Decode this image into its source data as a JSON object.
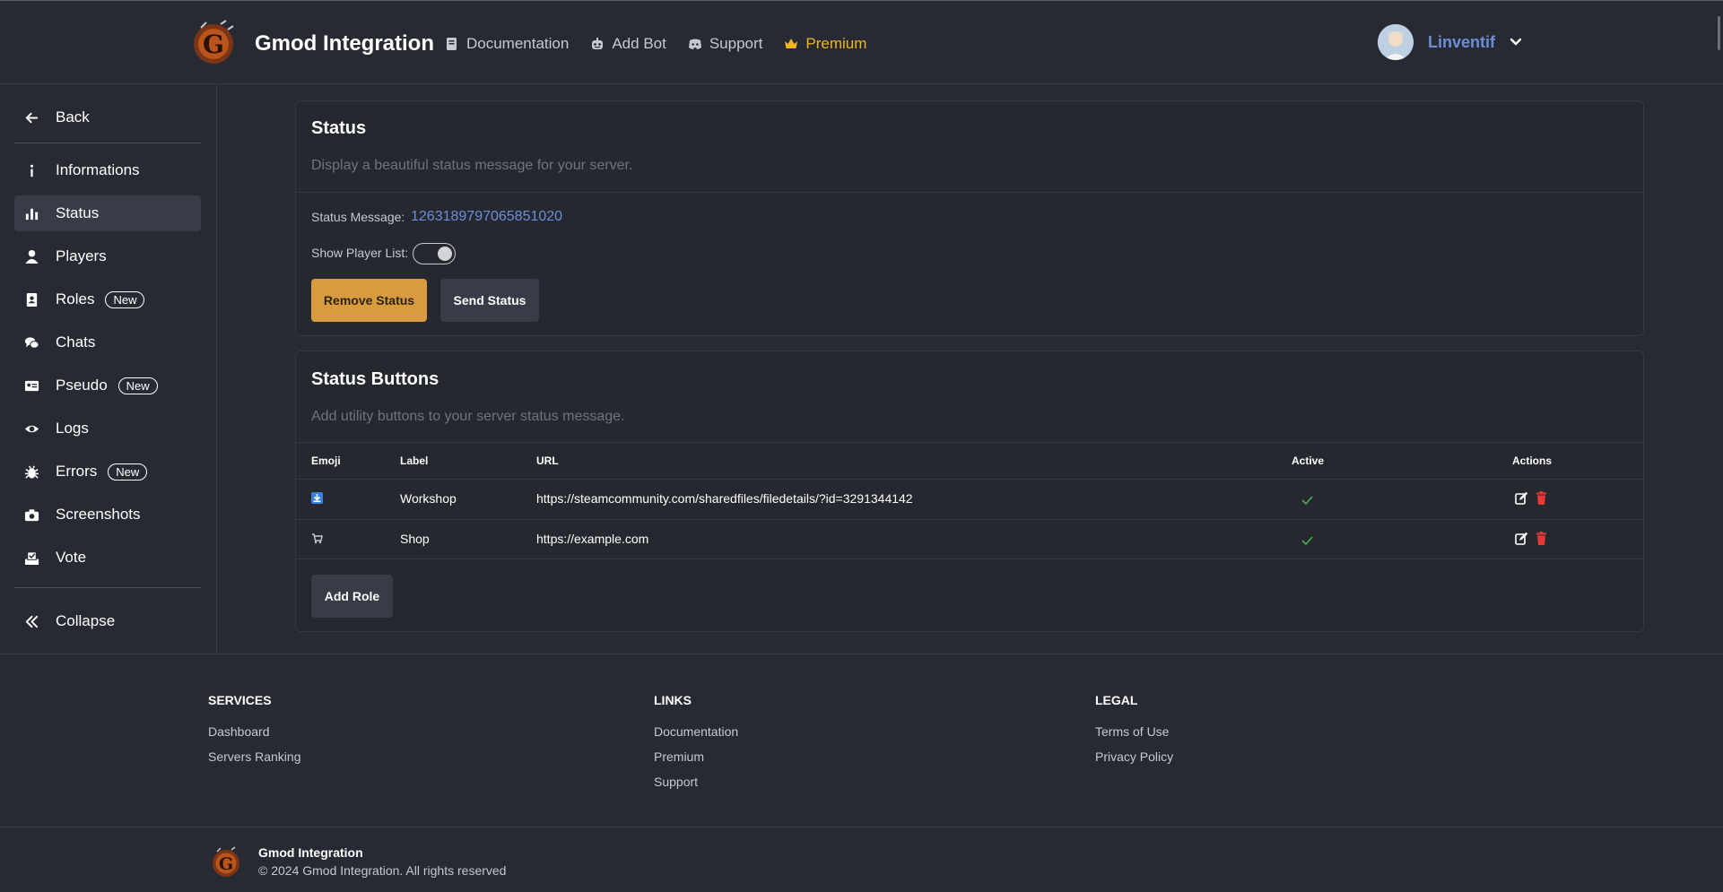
{
  "header": {
    "brand": "Gmod Integration",
    "nav": [
      {
        "label": "Documentation",
        "icon": "book-icon"
      },
      {
        "label": "Add Bot",
        "icon": "robot-icon"
      },
      {
        "label": "Support",
        "icon": "discord-icon"
      },
      {
        "label": "Premium",
        "icon": "crown-icon"
      }
    ],
    "user": {
      "name": "Linventif"
    }
  },
  "sidebar": {
    "back": "Back",
    "items": [
      {
        "label": "Informations",
        "icon": "info-icon"
      },
      {
        "label": "Status",
        "icon": "bar-chart-icon",
        "active": true
      },
      {
        "label": "Players",
        "icon": "user-icon"
      },
      {
        "label": "Roles",
        "icon": "contact-book-icon",
        "badge": "New"
      },
      {
        "label": "Chats",
        "icon": "chat-icon"
      },
      {
        "label": "Pseudo",
        "icon": "id-card-icon",
        "badge": "New"
      },
      {
        "label": "Logs",
        "icon": "eye-icon"
      },
      {
        "label": "Errors",
        "icon": "bug-icon",
        "badge": "New"
      },
      {
        "label": "Screenshots",
        "icon": "camera-icon"
      },
      {
        "label": "Vote",
        "icon": "vote-icon"
      }
    ],
    "collapse": "Collapse"
  },
  "status_card": {
    "title": "Status",
    "description": "Display a beautiful status message for your server.",
    "status_message_label": "Status Message:",
    "status_message_value": "1263189797065851020",
    "show_player_list_label": "Show Player List:",
    "show_player_list_on": true,
    "remove_button": "Remove Status",
    "send_button": "Send Status"
  },
  "buttons_card": {
    "title": "Status Buttons",
    "description": "Add utility buttons to your server status message.",
    "columns": {
      "emoji": "Emoji",
      "label": "Label",
      "url": "URL",
      "active": "Active",
      "actions": "Actions"
    },
    "rows": [
      {
        "emoji": "inbox-tray-icon",
        "label": "Workshop",
        "url": "https://steamcommunity.com/sharedfiles/filedetails/?id=3291344142",
        "active": true
      },
      {
        "emoji": "cart-icon",
        "label": "Shop",
        "url": "https://example.com",
        "active": true
      }
    ],
    "add_button": "Add Role"
  },
  "footer": {
    "services": {
      "title": "SERVICES",
      "links": [
        "Dashboard",
        "Servers Ranking"
      ]
    },
    "links": {
      "title": "LINKS",
      "links": [
        "Documentation",
        "Premium",
        "Support"
      ]
    },
    "legal": {
      "title": "LEGAL",
      "links": [
        "Terms of Use",
        "Privacy Policy"
      ]
    },
    "brand": "Gmod Integration",
    "copyright": "© 2024 Gmod Integration. All rights reserved"
  },
  "colors": {
    "background": "#282a33",
    "accent": "#6b8fd6",
    "premium": "#f0b429",
    "warning_button": "#d99b3f",
    "success": "#4caf50",
    "danger": "#e53935"
  }
}
